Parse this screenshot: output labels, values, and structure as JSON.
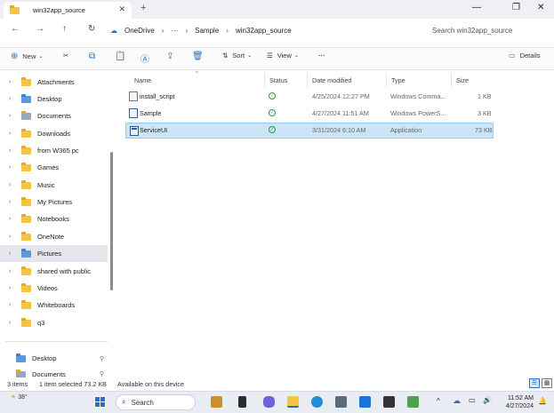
{
  "window": {
    "tab_title": "win32app_source",
    "tab_close": "✕",
    "new_tab": "+",
    "minimize": "—",
    "maximize": "❐",
    "close": "✕"
  },
  "nav": {
    "back": "←",
    "forward": "→",
    "up": "↑",
    "refresh": "↻"
  },
  "breadcrumb": {
    "home_icon": "☁",
    "items": [
      "OneDrive",
      "···",
      "Sample",
      "win32app_source"
    ],
    "separator": "›"
  },
  "search": {
    "placeholder": "Search win32app_source"
  },
  "commandbar": {
    "new_label": "New",
    "sort_label": "Sort",
    "view_label": "View",
    "more": "···",
    "details_label": "Details"
  },
  "sidebar": {
    "items": [
      {
        "label": "Attachments"
      },
      {
        "label": "Desktop"
      },
      {
        "label": "Documents"
      },
      {
        "label": "Downloads"
      },
      {
        "label": "from W365 pc"
      },
      {
        "label": "Games"
      },
      {
        "label": "Music"
      },
      {
        "label": "My Pictures"
      },
      {
        "label": "Notebooks"
      },
      {
        "label": "OneNote"
      },
      {
        "label": "Pictures"
      },
      {
        "label": "shared with public"
      },
      {
        "label": "Videos"
      },
      {
        "label": "Whiteboards"
      },
      {
        "label": "q3"
      }
    ],
    "quick": [
      {
        "label": "Desktop"
      },
      {
        "label": "Documents"
      }
    ]
  },
  "columns": {
    "name": "Name",
    "status": "Status",
    "date": "Date modified",
    "type": "Type",
    "size": "Size"
  },
  "files": [
    {
      "name": "install_script",
      "date": "4/25/2024 12:27 PM",
      "type": "Windows Comma...",
      "size": "1 KB"
    },
    {
      "name": "Sample",
      "date": "4/27/2024 11:51 AM",
      "type": "Windows PowerS...",
      "size": "3 KB"
    },
    {
      "name": "ServiceUI",
      "date": "3/31/2024 6:10 AM",
      "type": "Application",
      "size": "73 KB"
    }
  ],
  "status": {
    "items": "3 items",
    "selected": "1 item selected  73.2 KB",
    "availability": "Available on this device"
  },
  "taskbar": {
    "weather_temp": "38°",
    "search_label": "Search",
    "time": "11:52 AM",
    "date": "4/27/2024",
    "tray_up": "^"
  },
  "colors": {
    "accent": "#2a6fba",
    "selection": "#cce4f7",
    "folder": "#f4c542",
    "sync_ok": "#2b9a3e"
  }
}
